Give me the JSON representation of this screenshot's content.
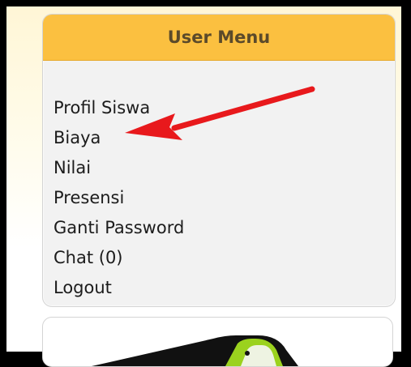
{
  "user_menu": {
    "title": "User Menu",
    "items": [
      {
        "label": "Profil Siswa"
      },
      {
        "label": "Biaya"
      },
      {
        "label": "Nilai"
      },
      {
        "label": "Presensi"
      },
      {
        "label": "Ganti Password"
      },
      {
        "label": "Chat (0)"
      },
      {
        "label": "Logout"
      }
    ]
  },
  "colors": {
    "header": "#fbc040",
    "panel": "#f2f2f2",
    "arrow": "#e8191c",
    "banner_accent": "#9bd21e"
  },
  "icons": {
    "annotation": "red-arrow-icon"
  }
}
